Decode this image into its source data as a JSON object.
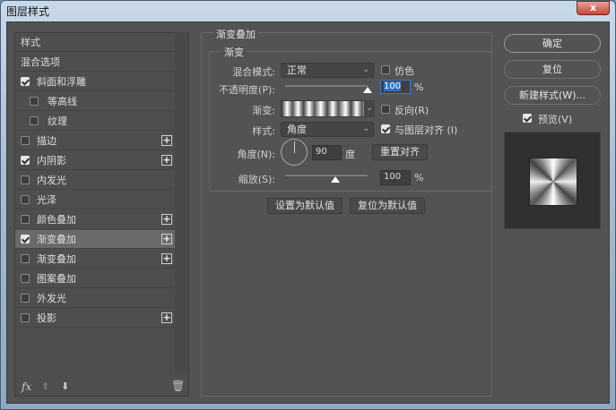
{
  "window": {
    "title": "图层样式",
    "close": "x"
  },
  "sidebar": {
    "items": [
      {
        "label": "样式",
        "checkbox": false,
        "checked": false,
        "plus": false,
        "indent": false
      },
      {
        "label": "混合选项",
        "checkbox": false,
        "checked": false,
        "plus": false,
        "indent": false
      },
      {
        "label": "斜面和浮雕",
        "checkbox": true,
        "checked": true,
        "plus": false,
        "indent": false
      },
      {
        "label": "等高线",
        "checkbox": true,
        "checked": false,
        "plus": false,
        "indent": true
      },
      {
        "label": "纹理",
        "checkbox": true,
        "checked": false,
        "plus": false,
        "indent": true
      },
      {
        "label": "描边",
        "checkbox": true,
        "checked": false,
        "plus": true,
        "indent": false
      },
      {
        "label": "内阴影",
        "checkbox": true,
        "checked": true,
        "plus": true,
        "indent": false
      },
      {
        "label": "内发光",
        "checkbox": true,
        "checked": false,
        "plus": false,
        "indent": false
      },
      {
        "label": "光泽",
        "checkbox": true,
        "checked": false,
        "plus": false,
        "indent": false
      },
      {
        "label": "颜色叠加",
        "checkbox": true,
        "checked": false,
        "plus": true,
        "indent": false
      },
      {
        "label": "渐变叠加",
        "checkbox": true,
        "checked": true,
        "plus": true,
        "indent": false,
        "selected": true
      },
      {
        "label": "渐变叠加",
        "checkbox": true,
        "checked": false,
        "plus": true,
        "indent": false
      },
      {
        "label": "图案叠加",
        "checkbox": true,
        "checked": false,
        "plus": false,
        "indent": false
      },
      {
        "label": "外发光",
        "checkbox": true,
        "checked": false,
        "plus": false,
        "indent": false
      },
      {
        "label": "投影",
        "checkbox": true,
        "checked": false,
        "plus": true,
        "indent": false
      }
    ],
    "fx": "fx"
  },
  "panel": {
    "title": "渐变叠加",
    "subtitle": "渐变",
    "blend_label": "混合模式:",
    "blend_value": "正常",
    "dither_label": "仿色",
    "opacity_label": "不透明度(P):",
    "opacity_value": "100",
    "opacity_unit": "%",
    "opacity_fraction": 1.0,
    "gradient_label": "渐变:",
    "reverse_label": "反向(R)",
    "style_label": "样式:",
    "style_value": "角度",
    "align_label": "与图层对齐 (I)",
    "align_checked": true,
    "angle_label": "角度(N):",
    "angle_value": "90",
    "angle_unit": "度",
    "reset_align": "重置对齐",
    "scale_label": "缩放(S):",
    "scale_value": "100",
    "scale_unit": "%",
    "scale_fraction": 0.6,
    "set_default": "设置为默认值",
    "reset_default": "复位为默认值"
  },
  "right": {
    "ok": "确定",
    "reset": "复位",
    "new_style": "新建样式(W)...",
    "preview_label": "预览(V)",
    "preview_checked": true
  }
}
